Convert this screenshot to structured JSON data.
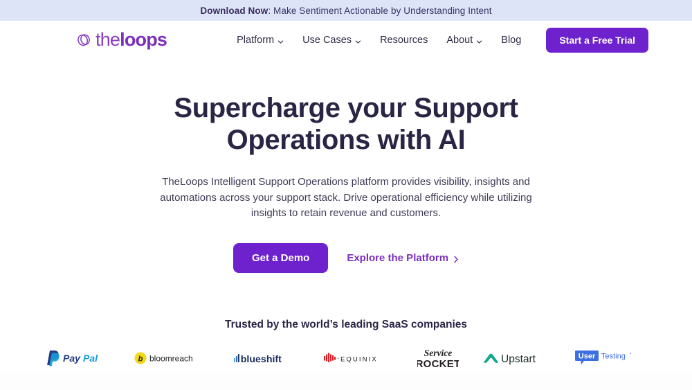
{
  "announcement": {
    "strong": "Download Now",
    "rest": ": Make Sentiment Actionable by Understanding Intent",
    "background": "#dde4f8"
  },
  "header": {
    "brand": {
      "icon": "two-loops-icon",
      "text_light": "the",
      "text_bold": "loops",
      "color": "#7b2fbd"
    },
    "nav": [
      {
        "label": "Platform",
        "has_dropdown": true
      },
      {
        "label": "Use Cases",
        "has_dropdown": true
      },
      {
        "label": "Resources",
        "has_dropdown": false
      },
      {
        "label": "About",
        "has_dropdown": true
      },
      {
        "label": "Blog",
        "has_dropdown": false
      }
    ],
    "cta": {
      "label": "Start a Free Trial",
      "color": "#6d22cd"
    }
  },
  "hero": {
    "title_line1": "Supercharge your Support",
    "title_line2": "Operations with AI",
    "subtitle": "TheLoops Intelligent Support Operations platform provides visibility, insights and automations across your support stack. Drive operational efficiency while utilizing insights to retain revenue and customers.",
    "primary_cta": "Get a Demo",
    "secondary_cta": "Explore the Platform",
    "secondary_cta_icon": "chevron-right-icon"
  },
  "trusted": {
    "heading": "Trusted by the world’s leading SaaS companies",
    "logos": [
      {
        "name": "PayPal",
        "part1": "Pay",
        "part2": "Pal",
        "color1": "#253b80",
        "color2": "#179bd7"
      },
      {
        "name": "bloomreach",
        "wordmark": "bloomreach",
        "mark": "b",
        "color1": "#f5d913",
        "color2": "#1c1c1c"
      },
      {
        "name": "blueshift",
        "wordmark": "blueshift",
        "color1": "#1b4f9c",
        "color2": "#1a2b5e"
      },
      {
        "name": "EQUINIX",
        "wordmark": "EQUINIX",
        "color1": "#d8232a",
        "color2": "#1a1a1a"
      },
      {
        "name": "ServiceRocket",
        "part1": "Service",
        "part2": "ROCKET",
        "color1": "#231f20"
      },
      {
        "name": "Upstart",
        "wordmark": "Upstart",
        "color1": "#12a88f",
        "color2": "#1d2b2a"
      },
      {
        "name": "UserTesting",
        "part1": "User",
        "part2": "Testing",
        "color1": "#3d6fe0",
        "color2": "#3d6fe0"
      }
    ]
  }
}
